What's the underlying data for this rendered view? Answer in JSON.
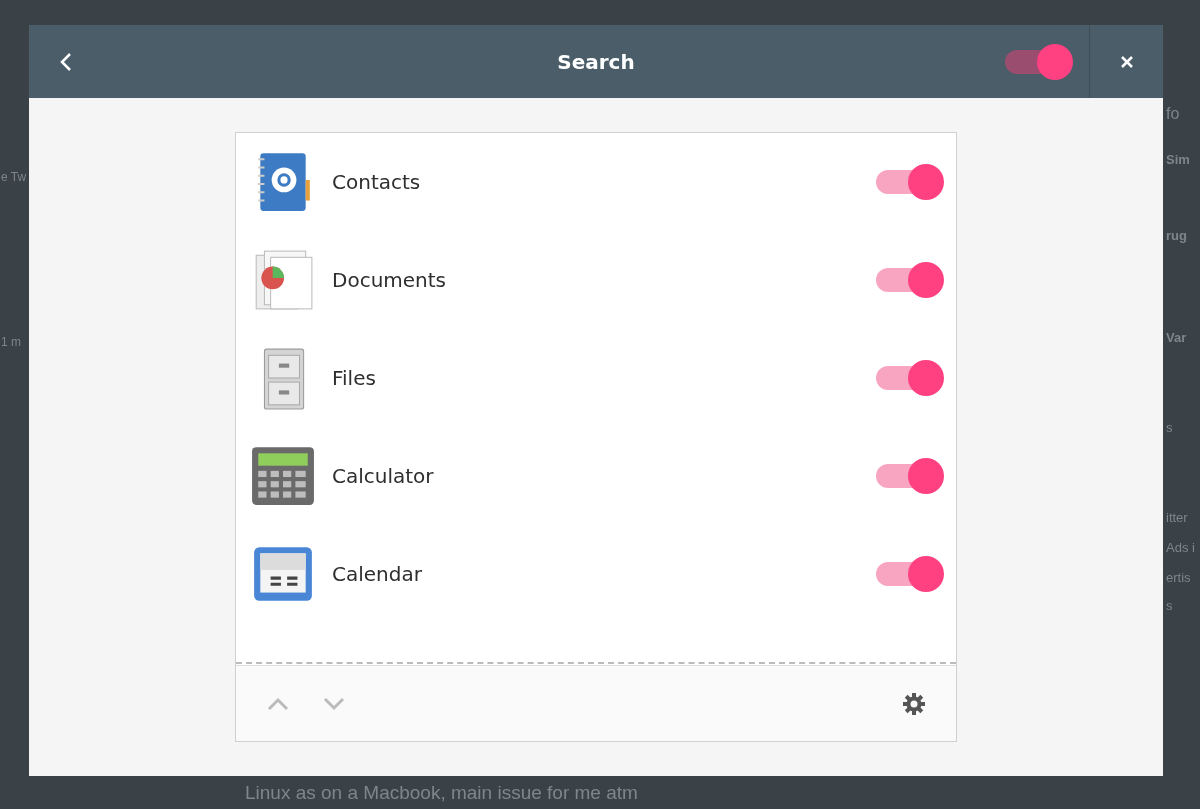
{
  "backdrop": {
    "left_fragments": [
      "e Tw",
      "1 m"
    ],
    "right_fragments": [
      "fo",
      "Sim",
      "rug",
      "Var",
      "s",
      "itter",
      "Ads i",
      "ertis",
      "s"
    ],
    "bottom_line": "Linux as on a Macbook, main issue for me atm"
  },
  "dialog": {
    "title": "Search",
    "enabled": true
  },
  "providers": [
    {
      "kind": "contacts",
      "name": "Contacts",
      "on": true
    },
    {
      "kind": "documents",
      "name": "Documents",
      "on": true
    },
    {
      "kind": "files",
      "name": "Files",
      "on": true
    },
    {
      "kind": "calculator",
      "name": "Calculator",
      "on": true
    },
    {
      "kind": "calendar",
      "name": "Calendar",
      "on": true
    }
  ]
}
